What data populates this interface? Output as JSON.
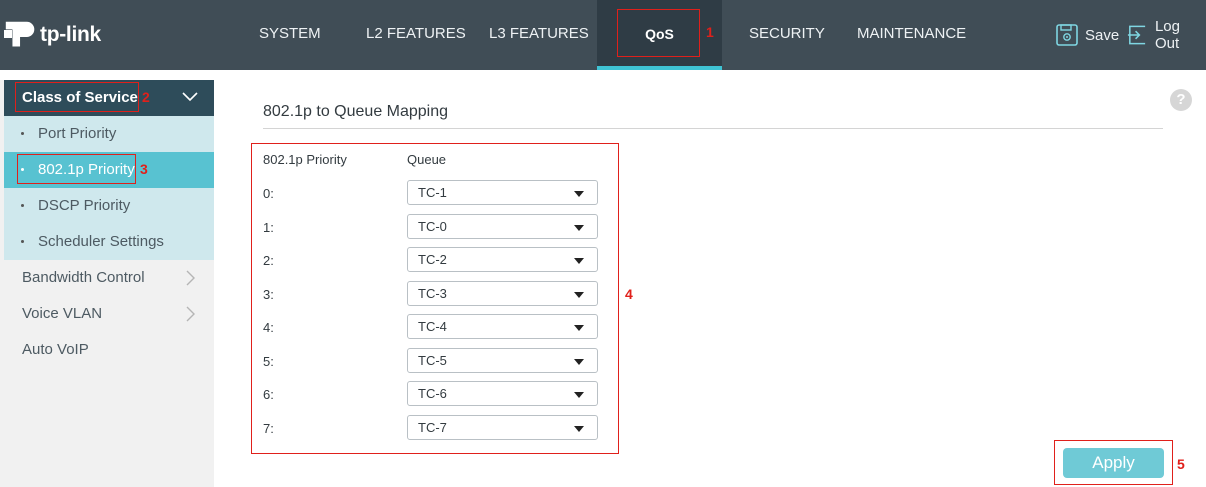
{
  "brand": {
    "name": "tp-link"
  },
  "nav": {
    "items": [
      "SYSTEM",
      "L2 FEATURES",
      "L3 FEATURES",
      "QoS",
      "SECURITY",
      "MAINTENANCE"
    ],
    "active": "QoS",
    "save_label": "Save",
    "logout_label": "Log Out"
  },
  "sidebar": {
    "section_label": "Class of Service",
    "sub_items": [
      "Port Priority",
      "802.1p Priority",
      "DSCP Priority",
      "Scheduler Settings"
    ],
    "active_sub_item": "802.1p Priority",
    "items": [
      "Bandwidth Control",
      "Voice VLAN",
      "Auto VoIP"
    ]
  },
  "main": {
    "title": "802.1p to Queue Mapping",
    "help_icon": "?",
    "col_priority": "802.1p Priority",
    "col_queue": "Queue",
    "rows": [
      {
        "priority": "0:",
        "queue": "TC-1"
      },
      {
        "priority": "1:",
        "queue": "TC-0"
      },
      {
        "priority": "2:",
        "queue": "TC-2"
      },
      {
        "priority": "3:",
        "queue": "TC-3"
      },
      {
        "priority": "4:",
        "queue": "TC-4"
      },
      {
        "priority": "5:",
        "queue": "TC-5"
      },
      {
        "priority": "6:",
        "queue": "TC-6"
      },
      {
        "priority": "7:",
        "queue": "TC-7"
      }
    ],
    "apply_label": "Apply"
  },
  "annotations": [
    "1",
    "2",
    "3",
    "4",
    "5"
  ],
  "colors": {
    "topbar": "#404d56",
    "accent": "#3fc3d4",
    "sidebar_header": "#2e4c5a",
    "sub_item_bg": "#cfe8ed",
    "active_item": "#58c2d1",
    "apply_button": "#6fcad6",
    "annotation_red": "#e0201b"
  }
}
